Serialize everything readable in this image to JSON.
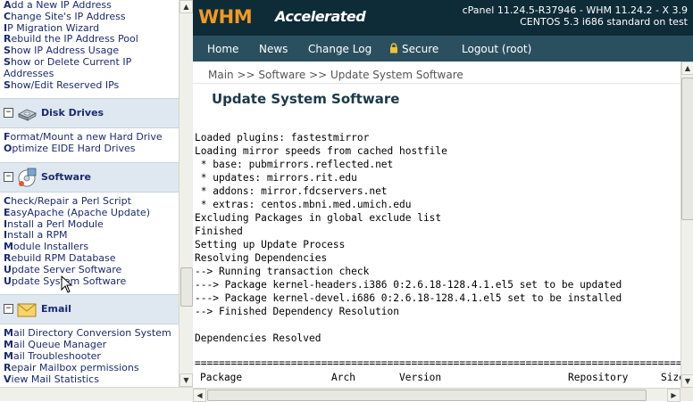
{
  "sidebar": {
    "links_top": [
      {
        "first": "A",
        "rest": "dd a New IP Address"
      },
      {
        "first": "C",
        "rest": "hange Site's IP Address"
      },
      {
        "first": "I",
        "rest": "P Migration Wizard"
      },
      {
        "first": "R",
        "rest": "ebuild the IP Address Pool"
      },
      {
        "first": "S",
        "rest": "how IP Address Usage"
      },
      {
        "first": "S",
        "rest": "how or Delete Current IP Addresses"
      },
      {
        "first": "S",
        "rest": "how/Edit Reserved IPs"
      }
    ],
    "disk_section": {
      "title": "Disk Drives",
      "toggle": "−",
      "icon": "disk-drive-icon"
    },
    "links_disk": [
      {
        "first": "F",
        "rest": "ormat/Mount a new Hard Drive"
      },
      {
        "first": "O",
        "rest": "ptimize EIDE Hard Drives"
      }
    ],
    "software_section": {
      "title": "Software",
      "toggle": "−",
      "icon": "software-package-icon"
    },
    "links_software": [
      {
        "first": "C",
        "rest": "heck/Repair a Perl Script"
      },
      {
        "first": "E",
        "rest": "asyApache (Apache Update)"
      },
      {
        "first": "I",
        "rest": "nstall a Perl Module"
      },
      {
        "first": "I",
        "rest": "nstall a RPM"
      },
      {
        "first": "M",
        "rest": "odule Installers"
      },
      {
        "first": "R",
        "rest": "ebuild RPM Database"
      },
      {
        "first": "U",
        "rest": "pdate Server Software"
      },
      {
        "first": "U",
        "rest": "pdate System Software"
      }
    ],
    "email_section": {
      "title": "Email",
      "toggle": "−",
      "icon": "envelope-icon"
    },
    "links_email": [
      {
        "first": "M",
        "rest": "ail Directory Conversion System"
      },
      {
        "first": "M",
        "rest": "ail Queue Manager"
      },
      {
        "first": "M",
        "rest": "ail Troubleshooter"
      },
      {
        "first": "R",
        "rest": "epair Mailbox permissions"
      },
      {
        "first": "V",
        "rest": "iew Mail Statistics"
      }
    ]
  },
  "header": {
    "logo_brand": "WHM",
    "logo_sub": "Accelerated",
    "version_line1": "cPanel 11.24.5-R37946 - WHM 11.24.2 - X 3.9",
    "version_line2": "CENTOS 5.3 i686 standard on test"
  },
  "nav": {
    "home": "Home",
    "news": "News",
    "changelog": "Change Log",
    "secure": "Secure",
    "logout": "Logout (root)"
  },
  "main": {
    "breadcrumb": "Main >> Software >> Update System Software",
    "title": "Update System Software",
    "console": "Loaded plugins: fastestmirror\nLoading mirror speeds from cached hostfile\n * base: pubmirrors.reflected.net\n * updates: mirrors.rit.edu\n * addons: mirror.fdcservers.net\n * extras: centos.mbni.med.umich.edu\nExcluding Packages in global exclude list\nFinished\nSetting up Update Process\nResolving Dependencies\n--> Running transaction check\n---> Package kernel-headers.i386 0:2.6.18-128.4.1.el5 set to be updated\n---> Package kernel-devel.i686 0:2.6.18-128.4.1.el5 set to be installed\n--> Finished Dependency Resolution\n\nDependencies Resolved",
    "separator": "==================================================================================",
    "table_headers": {
      "package": "Package",
      "arch": "Arch",
      "version": "Version",
      "repository": "Repository",
      "size": "Size"
    }
  },
  "colors": {
    "header_bg": "#0e2b38",
    "nav_bg": "#2a5060",
    "logo_orange": "#f29a1e",
    "link": "#1c2a6e",
    "section_bg": "#dfe8f0"
  }
}
